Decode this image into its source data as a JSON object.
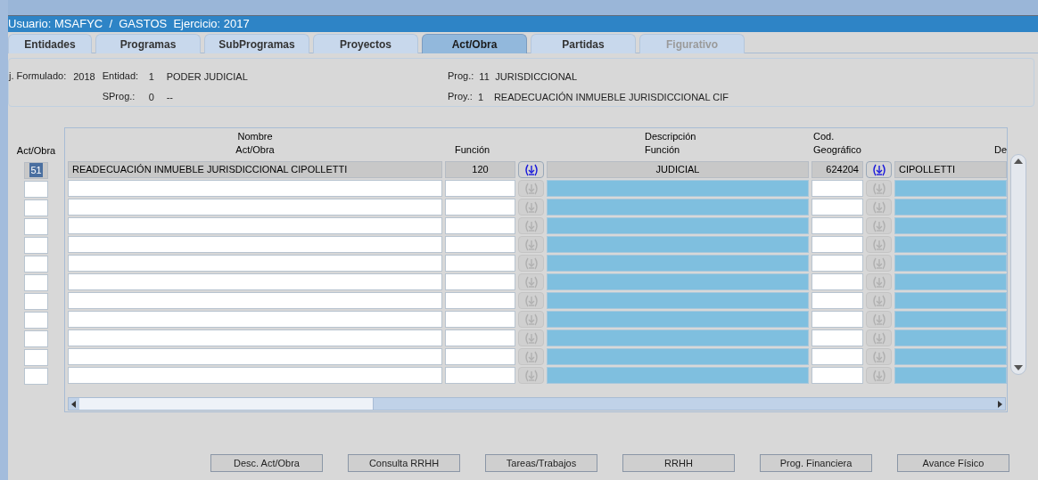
{
  "window": {
    "title": "Usuario: MSAFYC  /  GASTOS  Ejercicio: 2017"
  },
  "tabs": [
    {
      "label": "Entidades",
      "selected": false,
      "disabled": false
    },
    {
      "label": "Programas",
      "selected": false,
      "disabled": false
    },
    {
      "label": "SubProgramas",
      "selected": false,
      "disabled": false
    },
    {
      "label": "Proyectos",
      "selected": false,
      "disabled": false
    },
    {
      "label": "Act/Obra",
      "selected": true,
      "disabled": false
    },
    {
      "label": "Partidas",
      "selected": false,
      "disabled": false
    },
    {
      "label": "Figurativo",
      "selected": false,
      "disabled": true
    }
  ],
  "info": {
    "formulado": {
      "label": "j. Formulado:",
      "value": "2018"
    },
    "entidad": {
      "label": "Entidad:",
      "code": "1",
      "name": "PODER JUDICIAL"
    },
    "sprog": {
      "label": "SProg.:",
      "code": "0",
      "name": "--"
    },
    "prog": {
      "label": "Prog.:",
      "code": "11",
      "name": "JURISDICCIONAL"
    },
    "proy": {
      "label": "Proy.:",
      "code": "1",
      "name": "READECUACIÓN INMUEBLE JURISDICCIONAL CIF"
    }
  },
  "act_column_header": "Act/Obra",
  "table": {
    "columns": [
      {
        "lines": [
          "Nombre",
          "Act/Obra"
        ]
      },
      {
        "lines": [
          "Función"
        ]
      },
      {
        "lines": [
          "Descripción",
          "Función"
        ]
      },
      {
        "lines": [
          "Cod.",
          "Geográfico"
        ]
      },
      {
        "lines": [
          "De"
        ]
      }
    ],
    "rows": [
      {
        "kind": "data",
        "act": "51",
        "selected": true,
        "nombre": "READECUACIÓN INMUEBLE JURISDICCIONAL CIPOLLETTI",
        "funcion": "120",
        "descripcion": "JUDICIAL",
        "cod": "624204",
        "localidad": "CIPOLLETTI"
      },
      {
        "kind": "empty",
        "selected": false
      },
      {
        "kind": "empty",
        "selected": false
      },
      {
        "kind": "empty",
        "selected": false
      },
      {
        "kind": "empty",
        "selected": false
      },
      {
        "kind": "empty",
        "selected": false
      },
      {
        "kind": "empty",
        "selected": false
      },
      {
        "kind": "empty",
        "selected": false
      },
      {
        "kind": "empty",
        "selected": false
      },
      {
        "kind": "empty",
        "selected": false
      },
      {
        "kind": "empty",
        "selected": false
      },
      {
        "kind": "empty",
        "selected": false
      }
    ]
  },
  "buttons": [
    "Desc. Act/Obra",
    "Consulta RRHH",
    "Tareas/Trabajos",
    "RRHH",
    "Prog. Financiera",
    "Avance Físico"
  ]
}
